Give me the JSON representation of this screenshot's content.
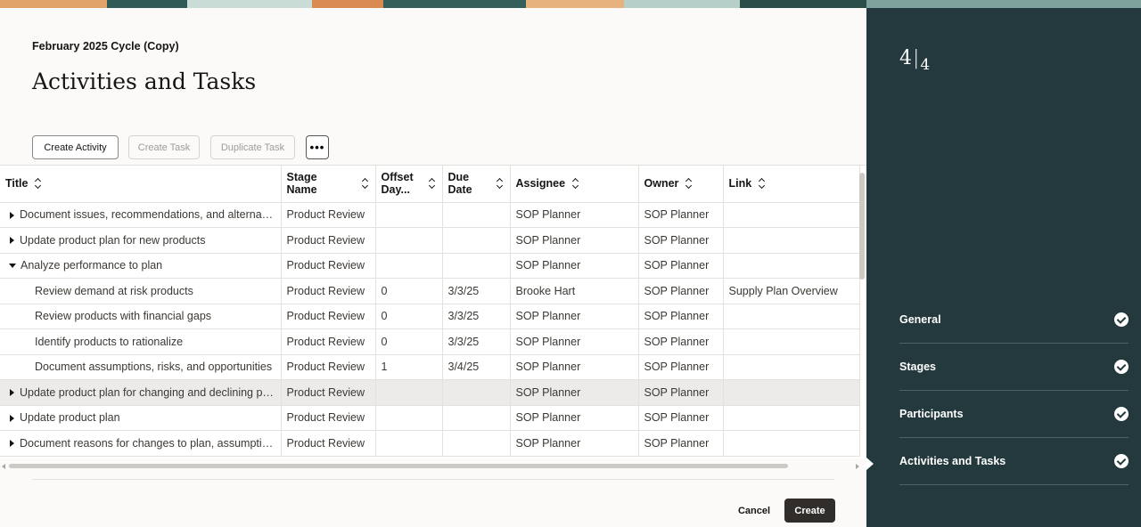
{
  "header": {
    "cycle_name": "February 2025 Cycle (Copy)",
    "page_title": "Activities and Tasks"
  },
  "toolbar": {
    "create_activity": "Create Activity",
    "create_task": "Create Task",
    "duplicate_task": "Duplicate Task",
    "more": "•••"
  },
  "table": {
    "columns": {
      "title": "Title",
      "stage_name": "Stage Name",
      "offset_days": "Offset Day...",
      "due_date": "Due Date",
      "assignee": "Assignee",
      "owner": "Owner",
      "link": "Link"
    },
    "rows": [
      {
        "title": "Document issues, recommendations, and alternatives",
        "stage": "Product Review",
        "offset": "",
        "due": "",
        "assignee": "SOP Planner",
        "owner": "SOP Planner",
        "link": ""
      },
      {
        "title": "Update product plan for new products",
        "stage": "Product Review",
        "offset": "",
        "due": "",
        "assignee": "SOP Planner",
        "owner": "SOP Planner",
        "link": ""
      },
      {
        "title": "Analyze performance to plan",
        "stage": "Product Review",
        "offset": "",
        "due": "",
        "assignee": "SOP Planner",
        "owner": "SOP Planner",
        "link": ""
      },
      {
        "title": "Review demand at risk products",
        "stage": "Product Review",
        "offset": "0",
        "due": "3/3/25",
        "assignee": "Brooke Hart",
        "owner": "SOP Planner",
        "link": "Supply Plan Overview"
      },
      {
        "title": "Review products with financial gaps",
        "stage": "Product Review",
        "offset": "0",
        "due": "3/3/25",
        "assignee": "SOP Planner",
        "owner": "SOP Planner",
        "link": ""
      },
      {
        "title": "Identify products to rationalize",
        "stage": "Product Review",
        "offset": "0",
        "due": "3/3/25",
        "assignee": "SOP Planner",
        "owner": "SOP Planner",
        "link": ""
      },
      {
        "title": "Document assumptions, risks, and opportunities",
        "stage": "Product Review",
        "offset": "1",
        "due": "3/4/25",
        "assignee": "SOP Planner",
        "owner": "SOP Planner",
        "link": ""
      },
      {
        "title": "Update product plan for changing and declining products",
        "stage": "Product Review",
        "offset": "",
        "due": "",
        "assignee": "SOP Planner",
        "owner": "SOP Planner",
        "link": ""
      },
      {
        "title": "Update product plan",
        "stage": "Product Review",
        "offset": "",
        "due": "",
        "assignee": "SOP Planner",
        "owner": "SOP Planner",
        "link": ""
      },
      {
        "title": "Document reasons for changes to plan, assumptions",
        "stage": "Product Review",
        "offset": "",
        "due": "",
        "assignee": "SOP Planner",
        "owner": "SOP Planner",
        "link": ""
      }
    ]
  },
  "footer": {
    "cancel": "Cancel",
    "create": "Create"
  },
  "sidebar": {
    "step_current": "4",
    "step_total": "4",
    "steps": [
      {
        "label": "General",
        "status": "complete"
      },
      {
        "label": "Stages",
        "status": "complete"
      },
      {
        "label": "Participants",
        "status": "complete"
      },
      {
        "label": "Activities and Tasks",
        "status": "complete"
      }
    ]
  },
  "colors": {
    "sidebar_bg": "#23393d",
    "primary_button": "#312d2a",
    "row_highlight": "#edebe9"
  }
}
